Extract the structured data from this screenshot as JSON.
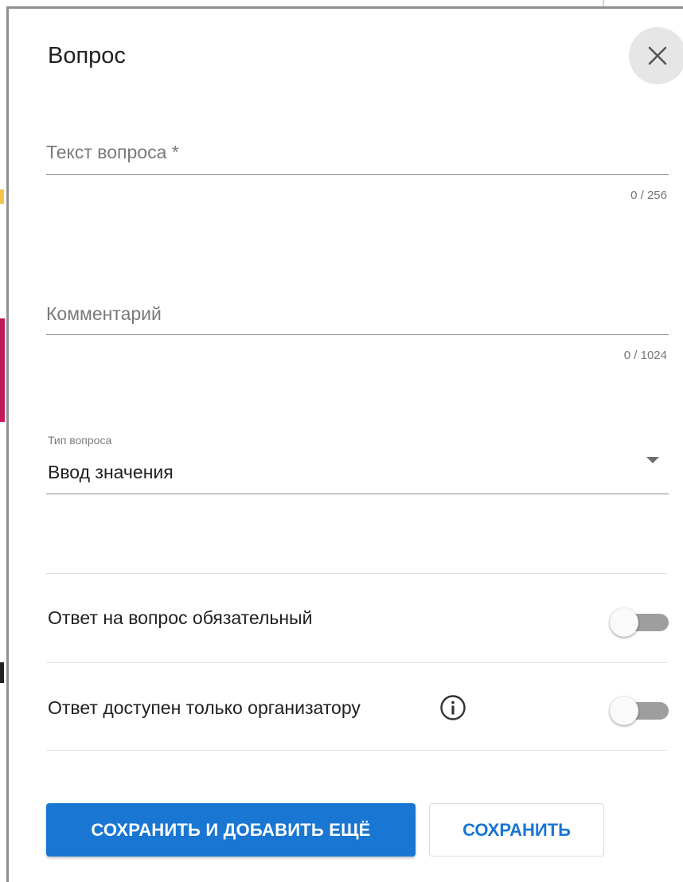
{
  "dialog": {
    "title": "Вопрос",
    "close_icon": "close-icon"
  },
  "question_text": {
    "placeholder": "Текст вопроса *",
    "value": "",
    "counter": "0 / 256"
  },
  "comment": {
    "placeholder": "Комментарий",
    "value": "",
    "counter": "0 / 1024"
  },
  "question_type": {
    "label": "Тип вопроса",
    "selected": "Ввод значения",
    "icon": "chevron-down-icon"
  },
  "required_toggle": {
    "label": "Ответ на вопрос обязательный",
    "checked": false
  },
  "organizer_only_toggle": {
    "label": "Ответ доступен только организатору",
    "info_icon": "info-icon",
    "checked": false
  },
  "actions": {
    "save_and_add_label": "СОХРАНИТЬ И ДОБАВИТЬ ЕЩЁ",
    "save_label": "СОХРАНИТЬ"
  },
  "colors": {
    "primary": "#1976d2",
    "toggle_off_track": "#9e9e9e",
    "toggle_thumb": "#fafafa"
  }
}
